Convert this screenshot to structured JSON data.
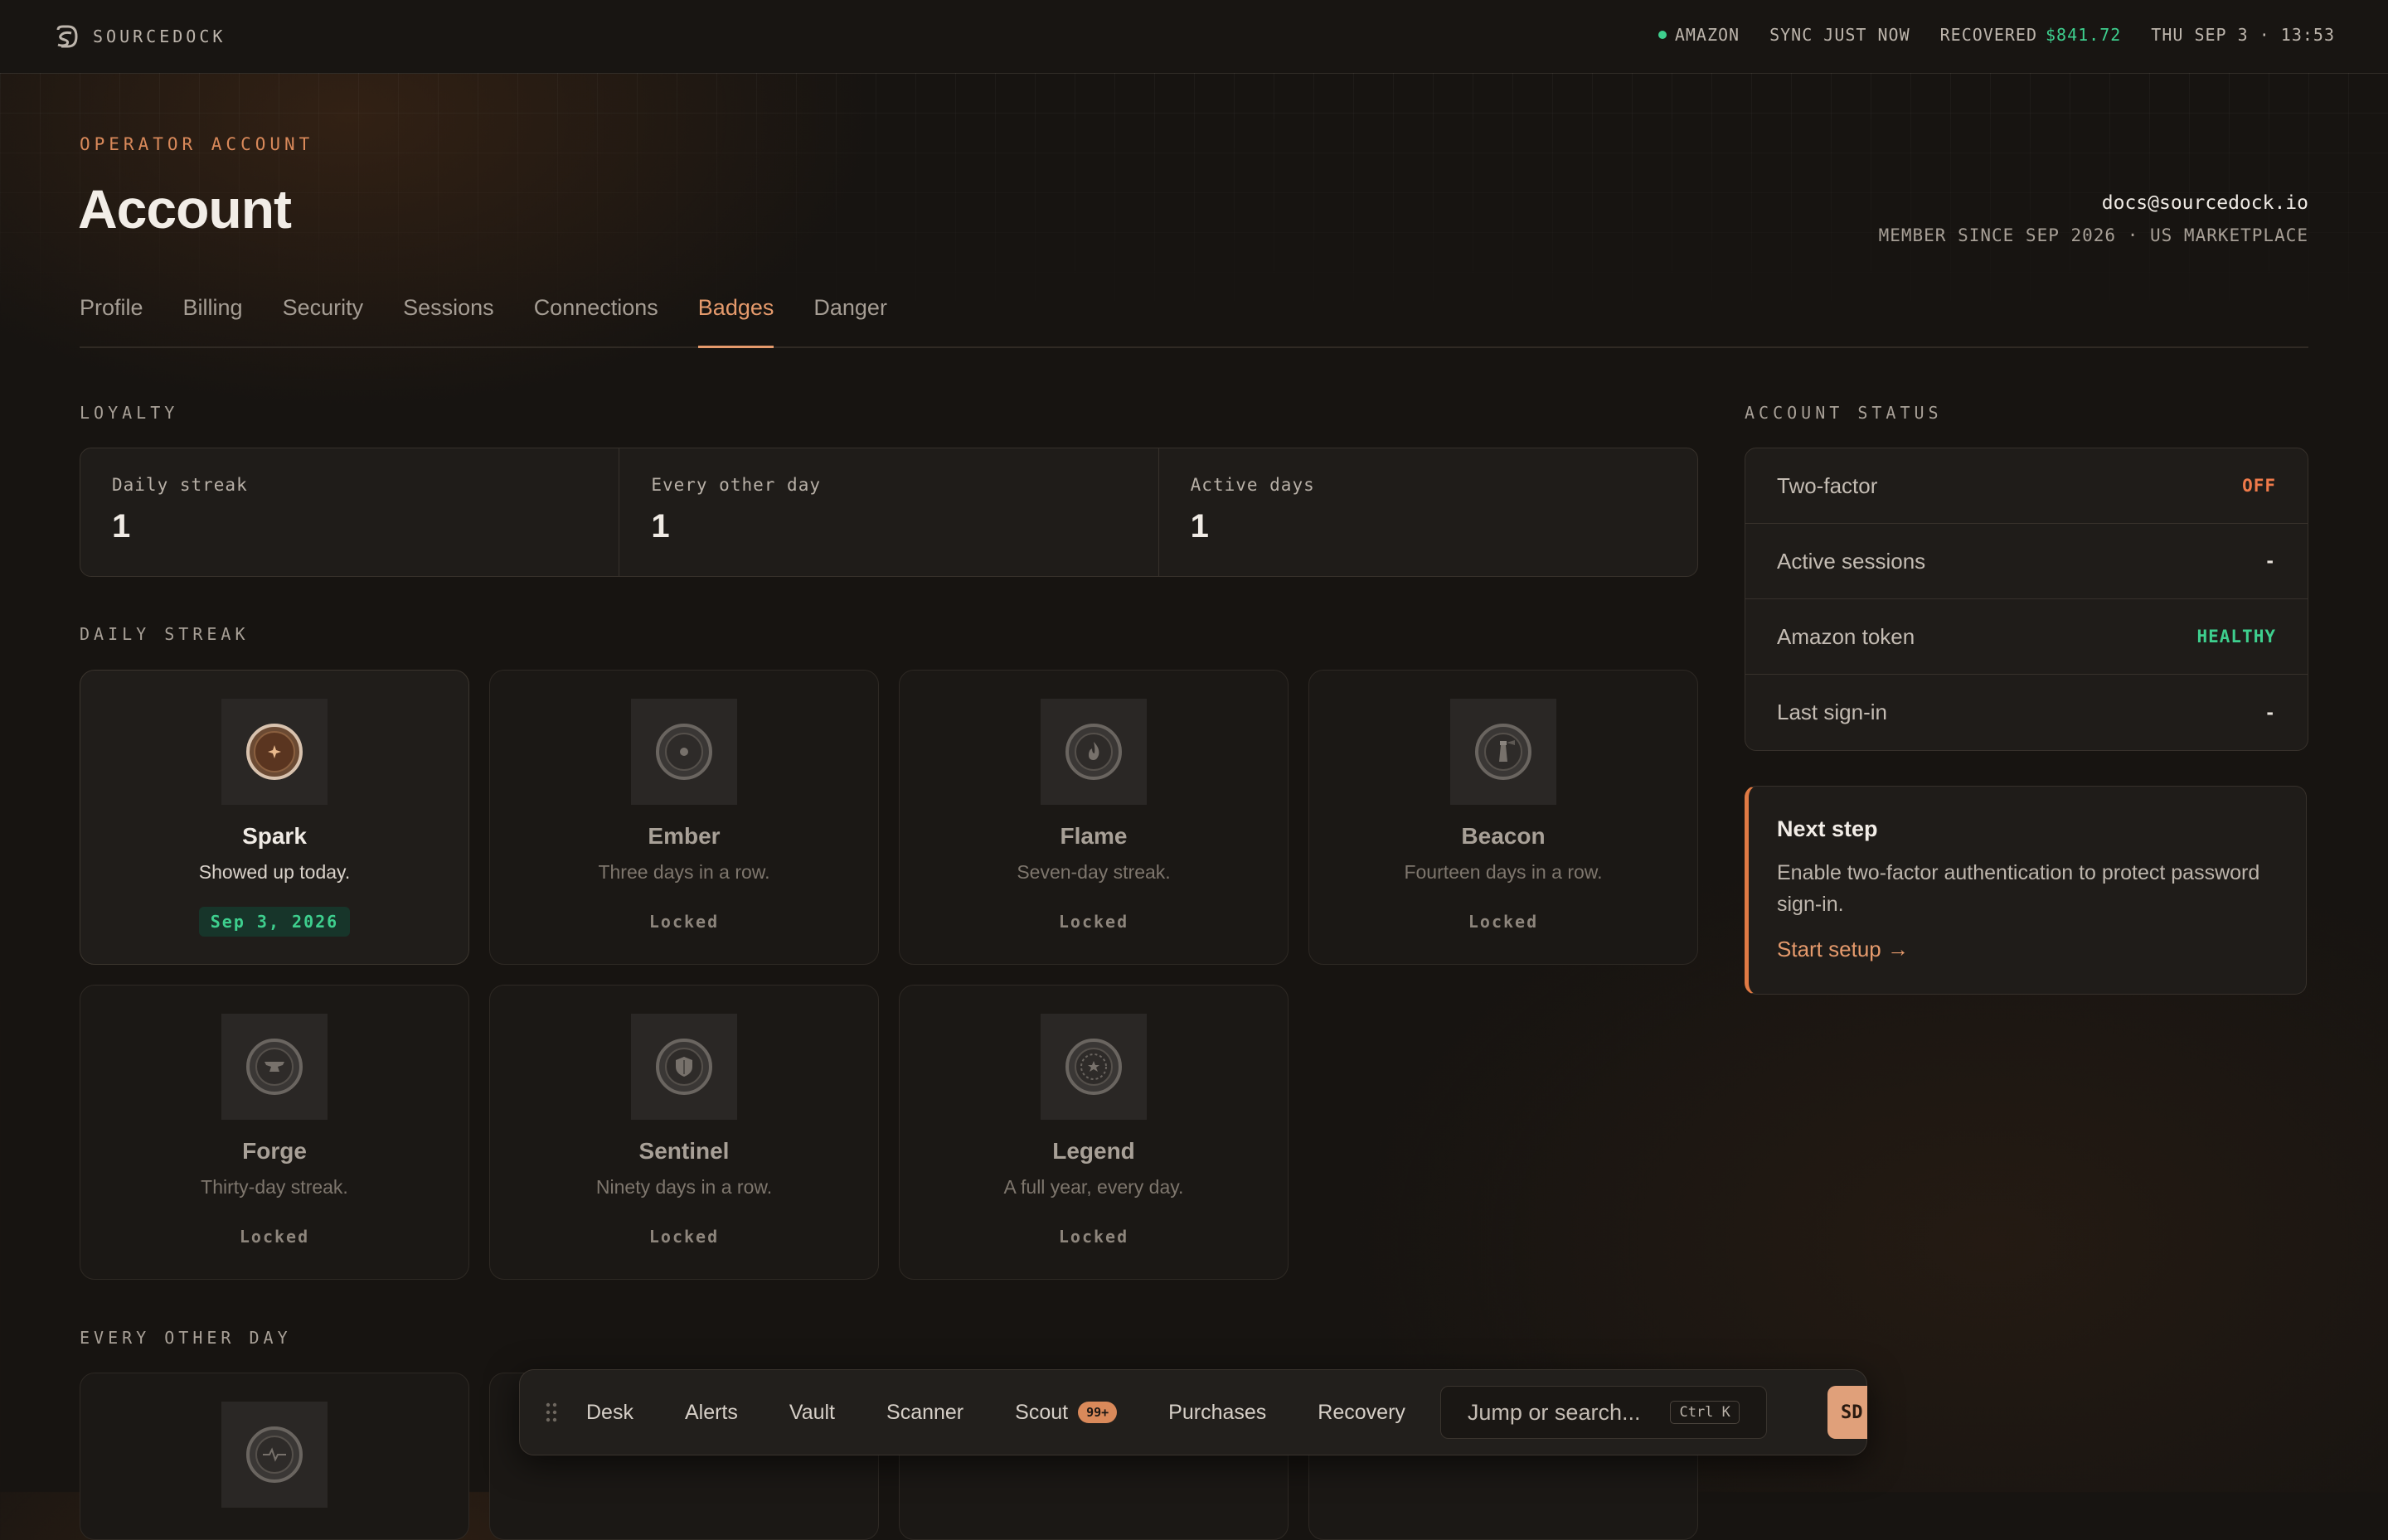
{
  "topbar": {
    "brand": "SOURCEDOCK",
    "marketplace": "AMAZON",
    "sync": "SYNC JUST NOW",
    "recovered_label": "RECOVERED",
    "recovered_value": "$841.72",
    "datetime": "THU SEP 3 · 13:53",
    "status_color": "#3ecf8e"
  },
  "header": {
    "eyebrow": "OPERATOR ACCOUNT",
    "title": "Account",
    "email": "docs@sourcedock.io",
    "member_since": "MEMBER SINCE SEP 2026 · US MARKETPLACE"
  },
  "tabs": [
    {
      "label": "Profile"
    },
    {
      "label": "Billing"
    },
    {
      "label": "Security"
    },
    {
      "label": "Sessions"
    },
    {
      "label": "Connections"
    },
    {
      "label": "Badges",
      "active": true
    },
    {
      "label": "Danger"
    }
  ],
  "loyalty": {
    "label": "LOYALTY",
    "stats": [
      {
        "label": "Daily streak",
        "value": "1"
      },
      {
        "label": "Every other day",
        "value": "1"
      },
      {
        "label": "Active days",
        "value": "1"
      }
    ]
  },
  "daily_streak": {
    "label": "DAILY STREAK",
    "badges": [
      {
        "name": "Spark",
        "desc": "Showed up today.",
        "status": "Sep 3, 2026",
        "unlocked": true,
        "icon": "spark-icon"
      },
      {
        "name": "Ember",
        "desc": "Three days in a row.",
        "status": "Locked",
        "icon": "ember-icon"
      },
      {
        "name": "Flame",
        "desc": "Seven-day streak.",
        "status": "Locked",
        "icon": "flame-icon"
      },
      {
        "name": "Beacon",
        "desc": "Fourteen days in a row.",
        "status": "Locked",
        "icon": "lighthouse-icon"
      },
      {
        "name": "Forge",
        "desc": "Thirty-day streak.",
        "status": "Locked",
        "icon": "anvil-icon"
      },
      {
        "name": "Sentinel",
        "desc": "Ninety days in a row.",
        "status": "Locked",
        "icon": "shield-icon"
      },
      {
        "name": "Legend",
        "desc": "A full year, every day.",
        "status": "Locked",
        "icon": "laurel-star-icon"
      }
    ]
  },
  "every_other_day": {
    "label": "EVERY OTHER DAY"
  },
  "account_status": {
    "label": "ACCOUNT STATUS",
    "rows": [
      {
        "label": "Two-factor",
        "value": "OFF"
      },
      {
        "label": "Active sessions",
        "value": "-"
      },
      {
        "label": "Amazon token",
        "value": "HEALTHY"
      },
      {
        "label": "Last sign-in",
        "value": "-"
      }
    ]
  },
  "next_step": {
    "title": "Next step",
    "body": "Enable two-factor authentication to protect password sign-in.",
    "link": "Start setup →"
  },
  "dock": {
    "items": [
      {
        "label": "Desk"
      },
      {
        "label": "Alerts"
      },
      {
        "label": "Vault"
      },
      {
        "label": "Scanner"
      },
      {
        "label": "Scout",
        "badge": "99+"
      },
      {
        "label": "Purchases"
      },
      {
        "label": "Recovery"
      }
    ],
    "search_placeholder": "Jump or search...",
    "shortcut": "Ctrl K",
    "avatar": "SD"
  },
  "colors": {
    "accent": "#e59a6c",
    "success": "#3ecf8e",
    "danger": "#ef7a4a",
    "background": "#171411"
  }
}
